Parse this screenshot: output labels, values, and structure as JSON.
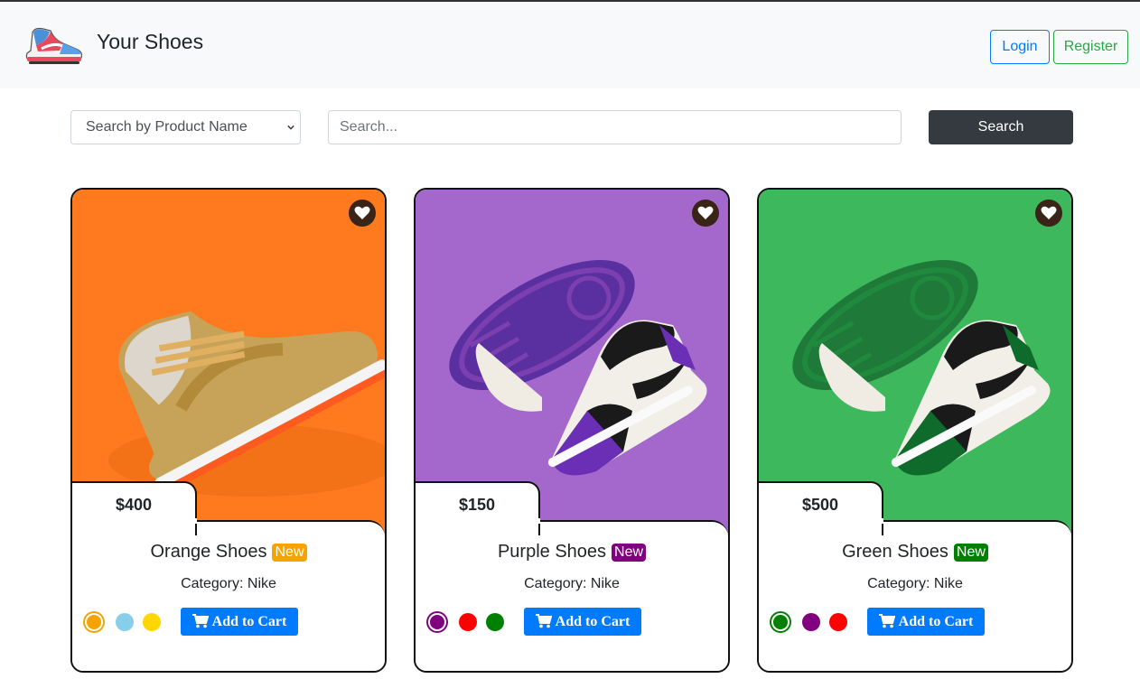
{
  "header": {
    "brand": "Your Shoes",
    "login_label": "Login",
    "register_label": "Register"
  },
  "search": {
    "select_value": "Search by Product Name",
    "placeholder": "Search...",
    "button_label": "Search"
  },
  "products": [
    {
      "name": "Orange Shoes",
      "badge": "New",
      "badge_color": "#f5a300",
      "price": "$400",
      "category": "Category: Nike",
      "bg_color": "#ff7a1f",
      "colors": [
        "#f5a300",
        "#87ceeb",
        "#ffd700"
      ],
      "selected_color_index": 0,
      "cart_label": "Add to Cart"
    },
    {
      "name": "Purple Shoes",
      "badge": "New",
      "badge_color": "#800080",
      "price": "$150",
      "category": "Category: Nike",
      "bg_color": "#a468cc",
      "colors": [
        "#800080",
        "#ff0000",
        "#008000"
      ],
      "selected_color_index": 0,
      "cart_label": "Add to Cart"
    },
    {
      "name": "Green Shoes",
      "badge": "New",
      "badge_color": "#008000",
      "price": "$500",
      "category": "Category: Nike",
      "bg_color": "#3db85c",
      "colors": [
        "#008000",
        "#800080",
        "#ff0000"
      ],
      "selected_color_index": 0,
      "cart_label": "Add to Cart"
    }
  ]
}
